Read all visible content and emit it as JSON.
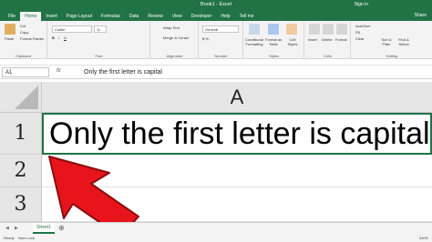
{
  "window": {
    "title": "Book1 - Excel",
    "sign_in": "Sign in",
    "share": "Share"
  },
  "tabs": [
    "File",
    "Home",
    "Insert",
    "Page Layout",
    "Formulas",
    "Data",
    "Review",
    "View",
    "Developer",
    "Help"
  ],
  "active_tab": "Home",
  "tell_me": "Tell me",
  "ribbon": {
    "clipboard": {
      "paste": "Paste",
      "cut": "Cut",
      "copy": "Copy",
      "format_painter": "Format Painter",
      "label": "Clipboard"
    },
    "font": {
      "name": "Calibri",
      "size": "11",
      "label": "Font"
    },
    "alignment": {
      "wrap_text": "Wrap Text",
      "merge_center": "Merge & Center",
      "label": "Alignment"
    },
    "number": {
      "format": "General",
      "label": "Number"
    },
    "styles": {
      "conditional": "Conditional Formatting",
      "format_table": "Format as Table",
      "cell_styles": "Cell Styles",
      "label": "Styles"
    },
    "cells": {
      "insert": "Insert",
      "delete": "Delete",
      "format": "Format",
      "label": "Cells"
    },
    "editing": {
      "autosum": "AutoSum",
      "fill": "Fill",
      "clear": "Clear",
      "sort_filter": "Sort & Filter",
      "find_select": "Find & Select",
      "label": "Editing"
    }
  },
  "formula_bar": {
    "name_box": "A1",
    "fx": "fx",
    "content": "Only the first letter is capital"
  },
  "grid": {
    "column": "A",
    "rows": [
      {
        "number": "1",
        "value": "Only the first letter is capital"
      },
      {
        "number": "2",
        "value": ""
      },
      {
        "number": "3",
        "value": ""
      }
    ]
  },
  "sheet_tab": "Sheet1",
  "status": {
    "ready": "Ready",
    "numlock": "Num Lock",
    "zoom": "340%"
  },
  "colors": {
    "brand": "#217346",
    "arrow": "#e8141b"
  }
}
